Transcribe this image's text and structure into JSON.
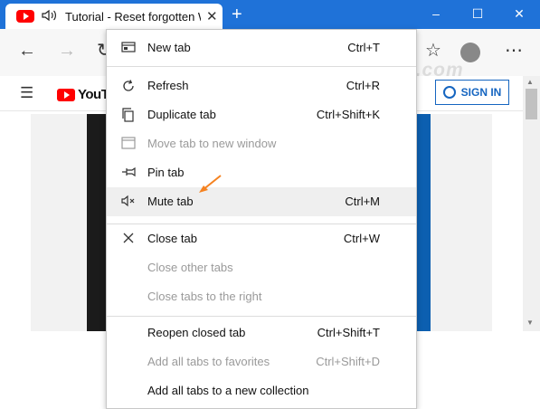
{
  "tab": {
    "title": "Tutorial - Reset forgotten W",
    "close": "✕"
  },
  "window": {
    "newtab": "+",
    "minimize": "–",
    "maximize": "☐",
    "close": "✕"
  },
  "toolbar": {
    "back": "←",
    "forward": "→",
    "refresh": "↻",
    "favorite": "☆",
    "more": "⋯"
  },
  "youtube": {
    "logo_text": "YouTube",
    "signin": "SIGN IN",
    "hamburger": "☰"
  },
  "watermark": "top-password.com",
  "menu": {
    "items": [
      {
        "label": "New tab",
        "shortcut": "Ctrl+T",
        "icon": "new-tab-icon",
        "disabled": false
      },
      {
        "label": "Refresh",
        "shortcut": "Ctrl+R",
        "icon": "refresh-icon",
        "disabled": false
      },
      {
        "label": "Duplicate tab",
        "shortcut": "Ctrl+Shift+K",
        "icon": "duplicate-icon",
        "disabled": false
      },
      {
        "label": "Move tab to new window",
        "shortcut": "",
        "icon": "window-icon",
        "disabled": true
      },
      {
        "label": "Pin tab",
        "shortcut": "",
        "icon": "pin-icon",
        "disabled": false
      },
      {
        "label": "Mute tab",
        "shortcut": "Ctrl+M",
        "icon": "mute-icon",
        "disabled": false
      },
      {
        "label": "Close tab",
        "shortcut": "Ctrl+W",
        "icon": "close-icon",
        "disabled": false
      },
      {
        "label": "Close other tabs",
        "shortcut": "",
        "icon": "",
        "disabled": true
      },
      {
        "label": "Close tabs to the right",
        "shortcut": "",
        "icon": "",
        "disabled": true
      },
      {
        "label": "Reopen closed tab",
        "shortcut": "Ctrl+Shift+T",
        "icon": "",
        "disabled": false
      },
      {
        "label": "Add all tabs to favorites",
        "shortcut": "Ctrl+Shift+D",
        "icon": "",
        "disabled": true
      },
      {
        "label": "Add all tabs to a new collection",
        "shortcut": "",
        "icon": "",
        "disabled": false
      }
    ]
  }
}
